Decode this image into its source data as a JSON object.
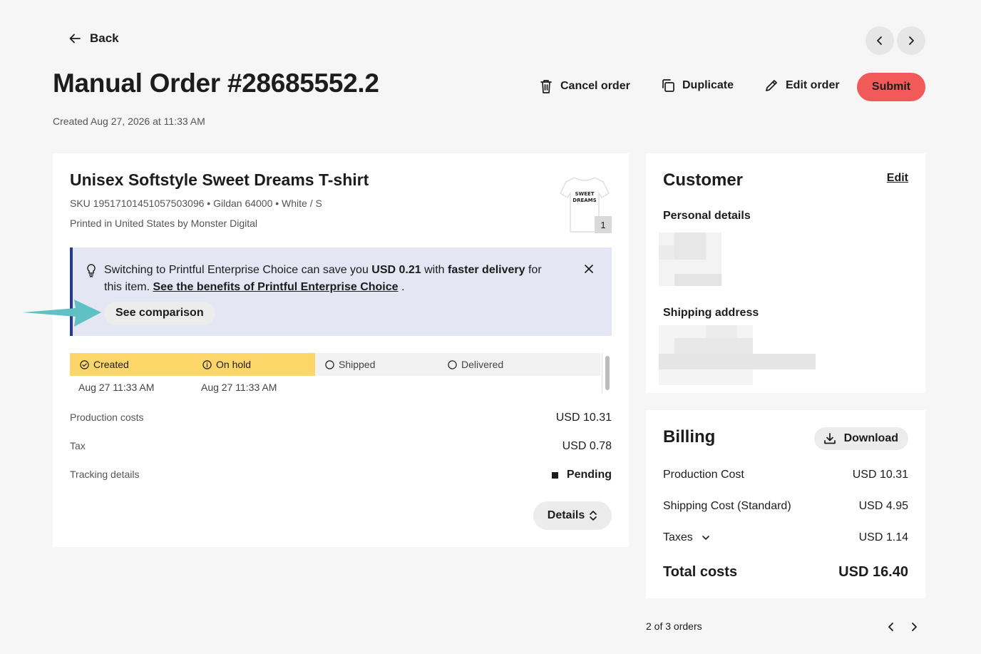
{
  "header": {
    "back_label": "Back",
    "title": "Manual Order #28685552.2",
    "created": "Created Aug 27, 2026 at 11:33 AM",
    "actions": {
      "cancel": "Cancel order",
      "duplicate": "Duplicate",
      "edit": "Edit order",
      "submit": "Submit"
    }
  },
  "product": {
    "title": "Unisex Softstyle Sweet Dreams T-shirt",
    "meta_line": "SKU 19517101451057503096 • Gildan 64000 • White / S",
    "printed_line": "Printed in United States by Monster Digital",
    "thumbnail_text": [
      "SWEET",
      "DREAMS"
    ],
    "quantity": "1"
  },
  "promo": {
    "text_1": "Switching to Printful Enterprise Choice can save you ",
    "amount": "USD 0.21",
    "text_2": " with ",
    "highlight": "faster delivery",
    "text_3": " for this item. ",
    "link": "See the benefits of Printful Enterprise Choice",
    "text_4": " .",
    "button": "See comparison"
  },
  "status": {
    "stages": [
      {
        "label": "Created",
        "date": "Aug 27 11:33 AM"
      },
      {
        "label": "On hold",
        "date": "Aug 27 11:33 AM"
      },
      {
        "label": "Shipped",
        "date": ""
      },
      {
        "label": "Delivered",
        "date": ""
      }
    ]
  },
  "summary": {
    "production_label": "Production costs",
    "production_value": "USD 10.31",
    "tax_label": "Tax",
    "tax_value": "USD 0.78",
    "tracking_label": "Tracking details",
    "tracking_value": "Pending",
    "details_button": "Details"
  },
  "customer": {
    "title": "Customer",
    "edit": "Edit",
    "personal_details": "Personal details",
    "shipping_address": "Shipping address"
  },
  "billing": {
    "title": "Billing",
    "download": "Download",
    "production_label": "Production Cost",
    "production_value": "USD 10.31",
    "shipping_label": "Shipping Cost (Standard)",
    "shipping_value": "USD 4.95",
    "taxes_label": "Taxes",
    "taxes_value": "USD 1.14",
    "total_label": "Total costs",
    "total_value": "USD 16.40"
  },
  "pagination": {
    "count": "2 of 3 orders"
  },
  "colors": {
    "accent": "#f25a5a",
    "status_fill": "#fdd66a",
    "promo_bg": "#e4e6f4",
    "promo_border": "#243a8c",
    "annotation_arrow": "#5fc1c4"
  },
  "icons": [
    "arrow-left-icon",
    "chevron-left-icon",
    "chevron-right-icon",
    "trash-icon",
    "duplicate-icon",
    "pencil-icon",
    "lightbulb-icon",
    "close-icon",
    "check-circle-icon",
    "info-circle-icon",
    "circle-icon",
    "download-icon",
    "chevron-down-icon",
    "chevron-up-down-icon"
  ]
}
